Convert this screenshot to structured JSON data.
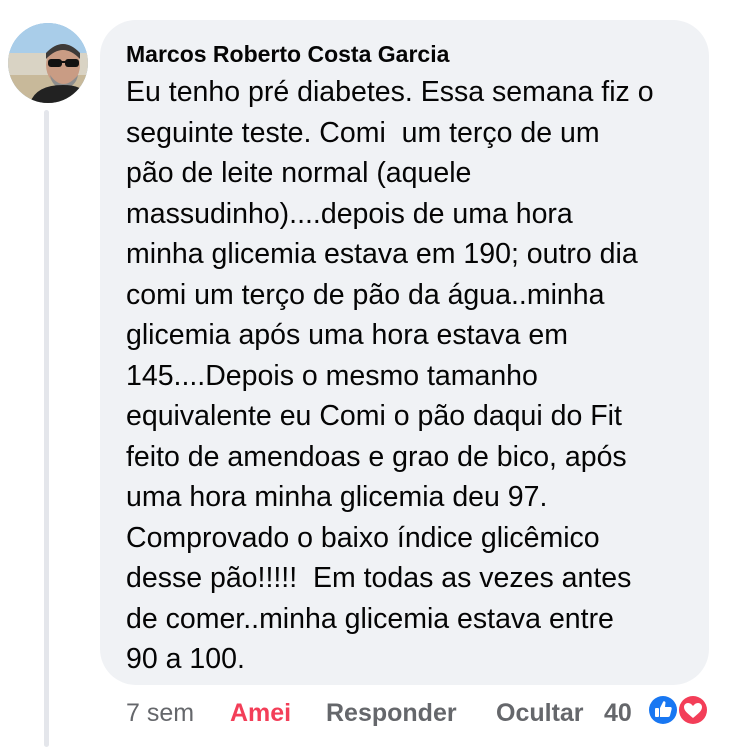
{
  "comment": {
    "author": "Marcos Roberto Costa Garcia",
    "text_lines": [
      "Eu tenho pré diabetes. Essa semana fiz o",
      "seguinte teste. Comi  um terço de um",
      "pão de leite normal (aquele",
      "massudinho)....depois de uma hora",
      "minha glicemia estava em 190; outro dia",
      "comi um terço de pão da água..minha",
      "glicemia após uma hora estava em",
      "145....Depois o mesmo tamanho",
      "equivalente eu Comi o pão daqui do Fit",
      "feito de amendoas e grao de bico, após",
      "uma hora minha glicemia deu 97.",
      "Comprovado o baixo índice glicêmico",
      "desse pão!!!!!  Em todas as vezes antes",
      "de comer..minha glicemia estava entre",
      "90 a 100."
    ]
  },
  "actions": {
    "time": "7 sem",
    "love_label": "Amei",
    "reply_label": "Responder",
    "hide_label": "Ocultar",
    "reaction_count": "40"
  },
  "reactions": [
    "like-icon",
    "love-icon"
  ],
  "colors": {
    "bubble": "#f0f2f5",
    "text": "#050505",
    "muted": "#65676b",
    "love": "#f33e58",
    "like": "#1877f2"
  }
}
